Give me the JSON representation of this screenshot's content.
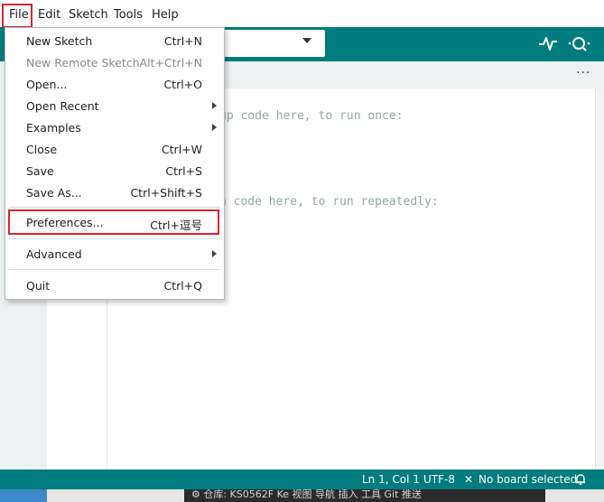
{
  "menubar": {
    "items": [
      "File",
      "Edit",
      "Sketch",
      "Tools",
      "Help"
    ]
  },
  "toolbar": {
    "board_select_value": "",
    "plotter_icon": "serial-plotter-icon",
    "monitor_icon": "serial-monitor-icon"
  },
  "tabstrip": {
    "more_label": "···"
  },
  "editor": {
    "lines": [
      "up code here, to run once:",
      "n code here, to run repeatedly:"
    ]
  },
  "file_menu": {
    "items": [
      {
        "label": "New Sketch",
        "shortcut": "Ctrl+N"
      },
      {
        "label": "New Remote Sketch",
        "shortcut": "Alt+Ctrl+N"
      },
      {
        "label": "Open...",
        "shortcut": "Ctrl+O"
      },
      {
        "label": "Open Recent",
        "shortcut": ""
      },
      {
        "label": "Examples",
        "shortcut": ""
      },
      {
        "label": "Close",
        "shortcut": "Ctrl+W"
      },
      {
        "label": "Save",
        "shortcut": "Ctrl+S"
      },
      {
        "label": "Save As...",
        "shortcut": "Ctrl+Shift+S"
      },
      {
        "label": "Preferences...",
        "shortcut": "Ctrl+逗号"
      },
      {
        "label": "Advanced",
        "shortcut": ""
      },
      {
        "label": "Quit",
        "shortcut": "Ctrl+Q"
      }
    ]
  },
  "statusbar": {
    "position": "Ln 1, Col 1",
    "encoding": "UTF-8",
    "board": "No board selected",
    "board_icon": "close-icon",
    "notification_icon": "bell-icon"
  },
  "taskbar": {
    "text": "⚙  仓库: KS0562F Ke    视图    导航    插入    工具    Git 推送"
  },
  "colors": {
    "accent": "#007c7e",
    "highlight": "#d9262c"
  }
}
